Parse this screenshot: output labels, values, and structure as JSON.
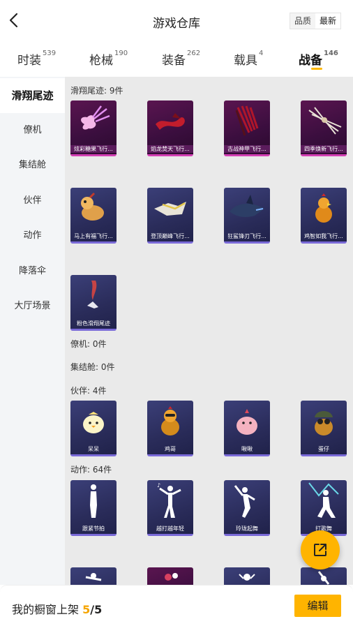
{
  "header": {
    "title": "游戏仓库",
    "sort_options": [
      "品质",
      "最新"
    ],
    "sort_active": "最新"
  },
  "tabs": [
    {
      "label": "时装",
      "count": "539"
    },
    {
      "label": "枪械",
      "count": "190"
    },
    {
      "label": "装备",
      "count": "262"
    },
    {
      "label": "载具",
      "count": "4"
    },
    {
      "label": "战备",
      "count": "146",
      "active": true
    }
  ],
  "sidebar": {
    "items": [
      "滑翔尾迹",
      "僚机",
      "集结舱",
      "伙伴",
      "动作",
      "降落伞",
      "大厅场景"
    ],
    "active": "滑翔尾迹"
  },
  "sections": {
    "glide": {
      "title": "滑翔尾迹: 9件",
      "items": [
        "炫彩糖果飞行...",
        "焰龙焚天飞行...",
        "古战神甲飞行...",
        "四季焕新飞行...",
        "马上有福飞行...",
        "登顶巅峰飞行...",
        "狂鲨锋刃飞行...",
        "鸡智如我飞行...",
        "粉色滑翔尾迹"
      ]
    },
    "wingman": {
      "title": "僚机: 0件"
    },
    "pod": {
      "title": "集结舱: 0件"
    },
    "partner": {
      "title": "伙伴: 4件",
      "items": [
        "呆呆",
        "鸡哥",
        "啾啾",
        "蛋仔"
      ]
    },
    "action": {
      "title": "动作: 64件",
      "items": [
        "跟紧节拍",
        "越打越年轻",
        "玲珑起舞",
        "打歌舞"
      ]
    }
  },
  "bottom": {
    "label": "我的橱窗上架",
    "current": "5",
    "separator": "/",
    "total": "5",
    "edit_label": "编辑"
  },
  "icons": {
    "back": "chevron-left-icon",
    "fab": "share-external-icon"
  },
  "colors": {
    "accent": "#ffb400",
    "glide_border": "#d23fb3",
    "item_border": "#7a6ad8"
  }
}
